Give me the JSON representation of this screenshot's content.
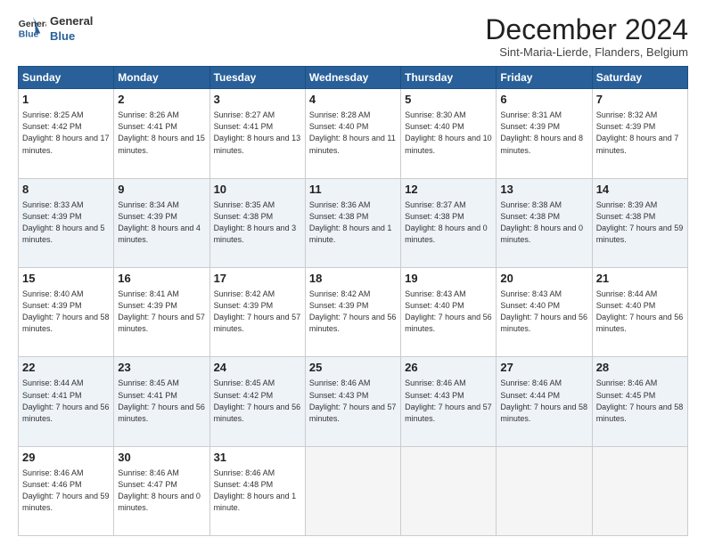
{
  "logo": {
    "line1": "General",
    "line2": "Blue"
  },
  "title": "December 2024",
  "location": "Sint-Maria-Lierde, Flanders, Belgium",
  "days_of_week": [
    "Sunday",
    "Monday",
    "Tuesday",
    "Wednesday",
    "Thursday",
    "Friday",
    "Saturday"
  ],
  "weeks": [
    [
      {
        "day": 1,
        "sunrise": "8:25 AM",
        "sunset": "4:42 PM",
        "daylight": "8 hours and 17 minutes."
      },
      {
        "day": 2,
        "sunrise": "8:26 AM",
        "sunset": "4:41 PM",
        "daylight": "8 hours and 15 minutes."
      },
      {
        "day": 3,
        "sunrise": "8:27 AM",
        "sunset": "4:41 PM",
        "daylight": "8 hours and 13 minutes."
      },
      {
        "day": 4,
        "sunrise": "8:28 AM",
        "sunset": "4:40 PM",
        "daylight": "8 hours and 11 minutes."
      },
      {
        "day": 5,
        "sunrise": "8:30 AM",
        "sunset": "4:40 PM",
        "daylight": "8 hours and 10 minutes."
      },
      {
        "day": 6,
        "sunrise": "8:31 AM",
        "sunset": "4:39 PM",
        "daylight": "8 hours and 8 minutes."
      },
      {
        "day": 7,
        "sunrise": "8:32 AM",
        "sunset": "4:39 PM",
        "daylight": "8 hours and 7 minutes."
      }
    ],
    [
      {
        "day": 8,
        "sunrise": "8:33 AM",
        "sunset": "4:39 PM",
        "daylight": "8 hours and 5 minutes."
      },
      {
        "day": 9,
        "sunrise": "8:34 AM",
        "sunset": "4:39 PM",
        "daylight": "8 hours and 4 minutes."
      },
      {
        "day": 10,
        "sunrise": "8:35 AM",
        "sunset": "4:38 PM",
        "daylight": "8 hours and 3 minutes."
      },
      {
        "day": 11,
        "sunrise": "8:36 AM",
        "sunset": "4:38 PM",
        "daylight": "8 hours and 1 minute."
      },
      {
        "day": 12,
        "sunrise": "8:37 AM",
        "sunset": "4:38 PM",
        "daylight": "8 hours and 0 minutes."
      },
      {
        "day": 13,
        "sunrise": "8:38 AM",
        "sunset": "4:38 PM",
        "daylight": "8 hours and 0 minutes."
      },
      {
        "day": 14,
        "sunrise": "8:39 AM",
        "sunset": "4:38 PM",
        "daylight": "7 hours and 59 minutes."
      }
    ],
    [
      {
        "day": 15,
        "sunrise": "8:40 AM",
        "sunset": "4:39 PM",
        "daylight": "7 hours and 58 minutes."
      },
      {
        "day": 16,
        "sunrise": "8:41 AM",
        "sunset": "4:39 PM",
        "daylight": "7 hours and 57 minutes."
      },
      {
        "day": 17,
        "sunrise": "8:42 AM",
        "sunset": "4:39 PM",
        "daylight": "7 hours and 57 minutes."
      },
      {
        "day": 18,
        "sunrise": "8:42 AM",
        "sunset": "4:39 PM",
        "daylight": "7 hours and 56 minutes."
      },
      {
        "day": 19,
        "sunrise": "8:43 AM",
        "sunset": "4:40 PM",
        "daylight": "7 hours and 56 minutes."
      },
      {
        "day": 20,
        "sunrise": "8:43 AM",
        "sunset": "4:40 PM",
        "daylight": "7 hours and 56 minutes."
      },
      {
        "day": 21,
        "sunrise": "8:44 AM",
        "sunset": "4:40 PM",
        "daylight": "7 hours and 56 minutes."
      }
    ],
    [
      {
        "day": 22,
        "sunrise": "8:44 AM",
        "sunset": "4:41 PM",
        "daylight": "7 hours and 56 minutes."
      },
      {
        "day": 23,
        "sunrise": "8:45 AM",
        "sunset": "4:41 PM",
        "daylight": "7 hours and 56 minutes."
      },
      {
        "day": 24,
        "sunrise": "8:45 AM",
        "sunset": "4:42 PM",
        "daylight": "7 hours and 56 minutes."
      },
      {
        "day": 25,
        "sunrise": "8:46 AM",
        "sunset": "4:43 PM",
        "daylight": "7 hours and 57 minutes."
      },
      {
        "day": 26,
        "sunrise": "8:46 AM",
        "sunset": "4:43 PM",
        "daylight": "7 hours and 57 minutes."
      },
      {
        "day": 27,
        "sunrise": "8:46 AM",
        "sunset": "4:44 PM",
        "daylight": "7 hours and 58 minutes."
      },
      {
        "day": 28,
        "sunrise": "8:46 AM",
        "sunset": "4:45 PM",
        "daylight": "7 hours and 58 minutes."
      }
    ],
    [
      {
        "day": 29,
        "sunrise": "8:46 AM",
        "sunset": "4:46 PM",
        "daylight": "7 hours and 59 minutes."
      },
      {
        "day": 30,
        "sunrise": "8:46 AM",
        "sunset": "4:47 PM",
        "daylight": "8 hours and 0 minutes."
      },
      {
        "day": 31,
        "sunrise": "8:46 AM",
        "sunset": "4:48 PM",
        "daylight": "8 hours and 1 minute."
      },
      null,
      null,
      null,
      null
    ]
  ]
}
